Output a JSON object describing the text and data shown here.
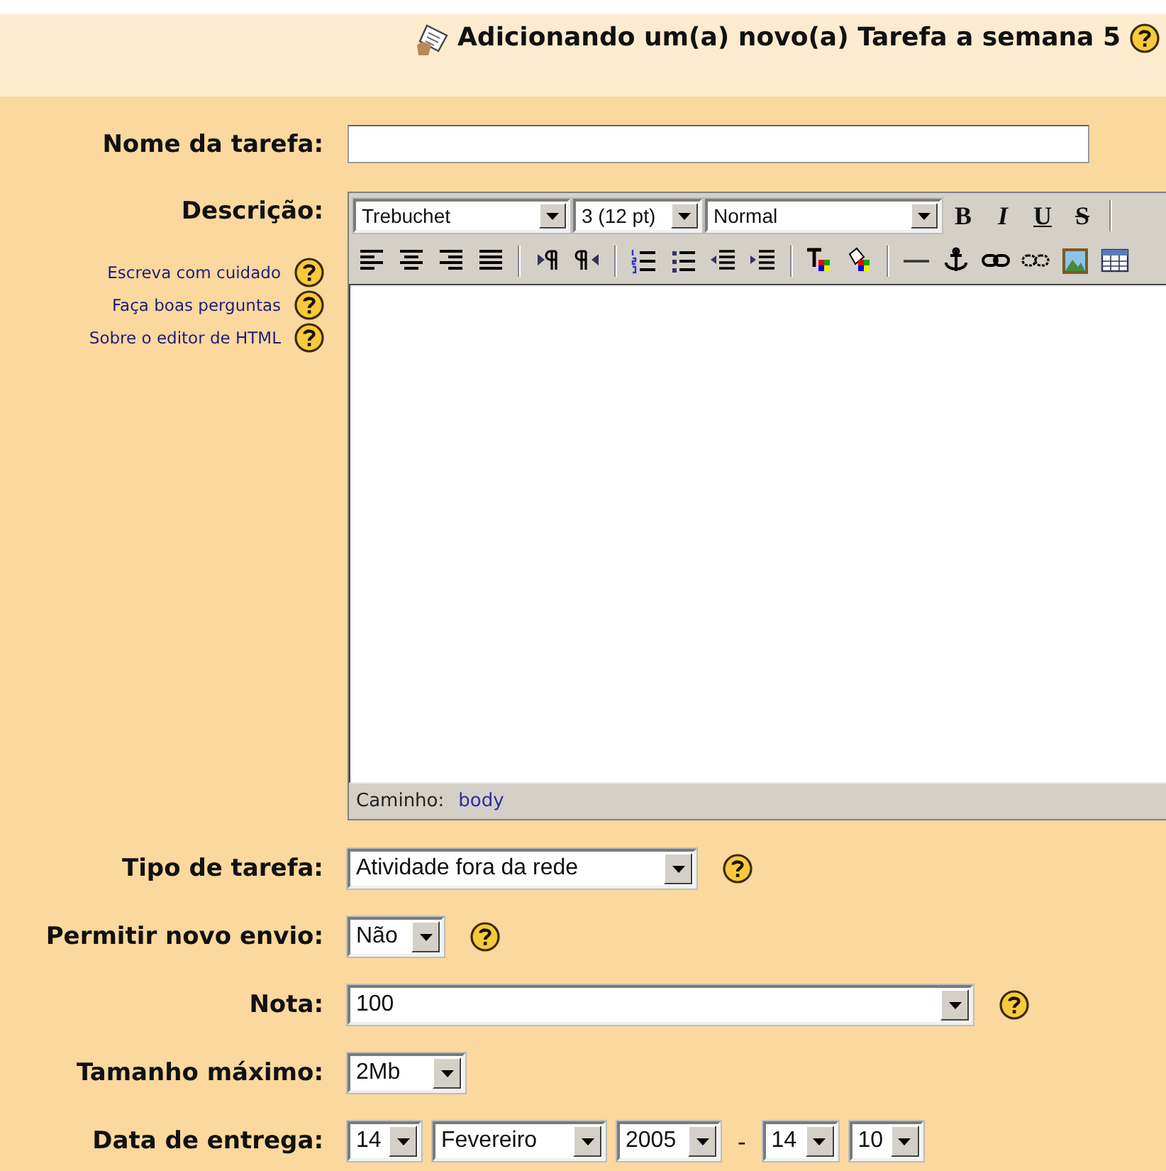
{
  "header": {
    "title": "Adicionando um(a) novo(a) Tarefa a semana 5",
    "help": true
  },
  "fields": [
    {
      "kind": "text",
      "label": "Nome da tarefa:"
    },
    {
      "kind": "editor",
      "label": "Descrição:",
      "help_links": [
        "Escreva com cuidado",
        "Faça boas perguntas",
        "Sobre o editor de HTML"
      ],
      "font": "Trebuchet",
      "size": "3 (12 pt)",
      "format": "Normal",
      "style_buttons": [
        "B",
        "I",
        "U",
        "S"
      ],
      "path_label": "Caminho:",
      "path": "body"
    },
    {
      "kind": "select",
      "label": "Tipo de tarefa:",
      "value": "Atividade fora da rede",
      "help": true
    },
    {
      "kind": "select",
      "label": "Permitir novo envio:",
      "value": "Não",
      "help": true
    },
    {
      "kind": "select",
      "label": "Nota:",
      "value": "100",
      "help": true
    },
    {
      "kind": "select",
      "label": "Tamanho máximo:",
      "value": "2Mb",
      "help": false
    },
    {
      "kind": "date",
      "label": "Data de entrega:",
      "date": [
        "14",
        "Fevereiro",
        "2005"
      ],
      "separator": "-",
      "time": [
        "14",
        "10"
      ]
    }
  ]
}
